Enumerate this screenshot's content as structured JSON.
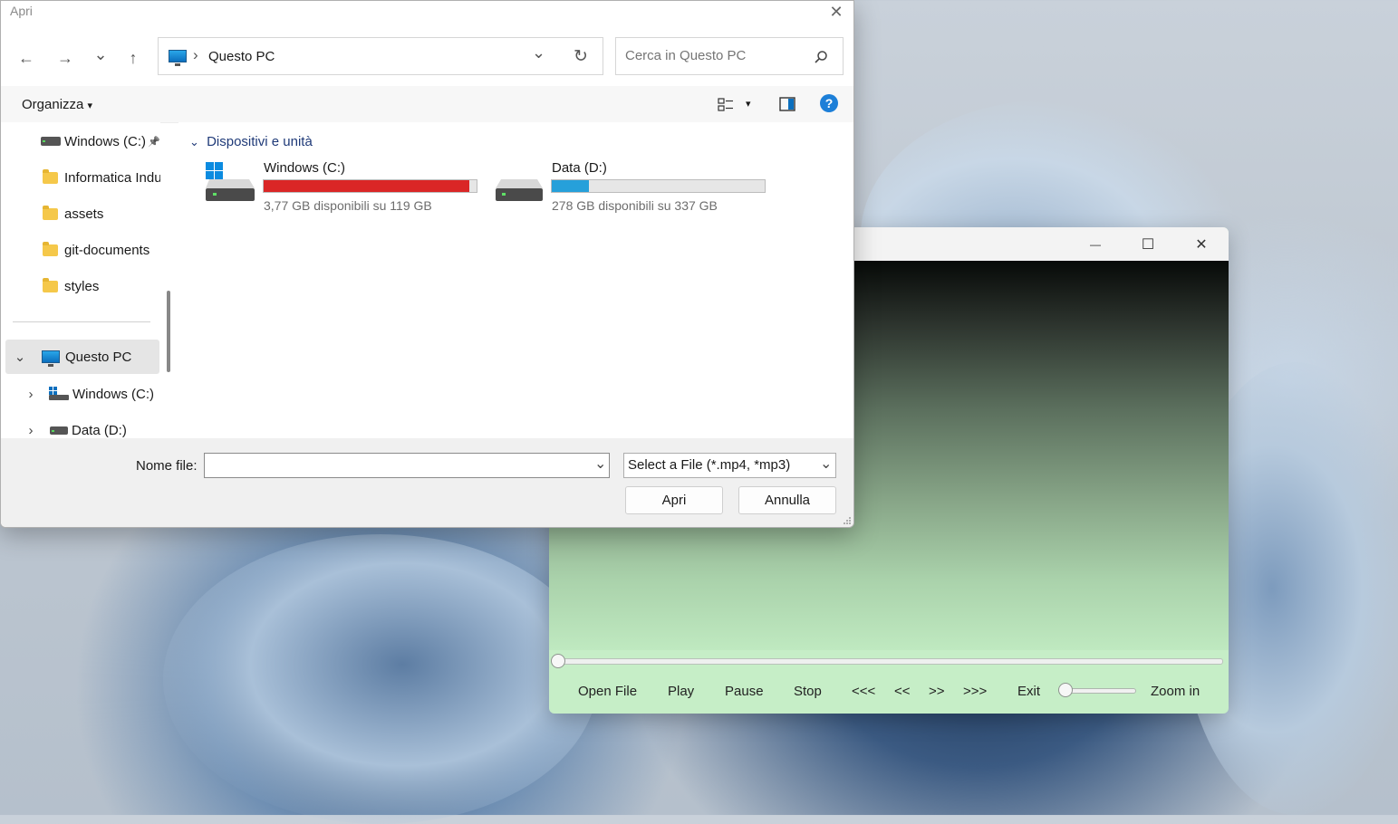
{
  "dialog": {
    "title": "Apri",
    "close_glyph": "✕",
    "nav": {
      "back": "←",
      "forward": "→",
      "recent": "⌄",
      "up": "↑"
    },
    "address": {
      "location": "Questo PC",
      "separator": "›",
      "chevron": "⌄",
      "refresh": "↻"
    },
    "search": {
      "placeholder": "Cerca in Questo PC"
    },
    "toolbar": {
      "organize_label": "Organizza",
      "organize_arrow": "▾",
      "view_arrow": "▾",
      "help": "?"
    },
    "sidebar": {
      "items": [
        {
          "label": "Windows (C:)",
          "icon": "drive-icon",
          "pin": "📌"
        },
        {
          "label": "Informatica Indu",
          "icon": "folder-icon"
        },
        {
          "label": "assets",
          "icon": "folder-icon"
        },
        {
          "label": "git-documents",
          "icon": "folder-icon"
        },
        {
          "label": "styles",
          "icon": "folder-icon"
        }
      ],
      "tree": [
        {
          "label": "Questo PC",
          "icon": "pc-icon",
          "expander": "⌄"
        },
        {
          "label": "Windows (C:)",
          "icon": "windows-drive-icon",
          "expander": "›"
        },
        {
          "label": "Data (D:)",
          "icon": "drive-icon",
          "expander": "›"
        }
      ]
    },
    "group": {
      "label": "Dispositivi e unità",
      "chevron": "⌄"
    },
    "drives": [
      {
        "name": "Windows (C:)",
        "free_text": "3,77 GB disponibili su 119 GB",
        "used_fraction": 0.968,
        "bar_color": "#da2626"
      },
      {
        "name": "Data (D:)",
        "free_text": "278 GB disponibili su 337 GB",
        "used_fraction": 0.175,
        "bar_color": "#26a0da"
      }
    ],
    "footer": {
      "filename_label": "Nome file:",
      "filename_value": "",
      "filetype_value": "Select a File (*.mp4, *mp3)",
      "dropdown_glyph": "⌄",
      "open_label": "Apri",
      "cancel_label": "Annulla"
    }
  },
  "player": {
    "window_controls": {
      "minimize": "—",
      "maximize": "☐",
      "close": "✕"
    },
    "seek_fraction": 0.0,
    "zoom_fraction": 0.0,
    "buttons": {
      "open": "Open File",
      "play": "Play",
      "pause": "Pause",
      "stop": "Stop",
      "rewind_fast": "<<<",
      "rewind": "<<",
      "forward": ">>",
      "forward_fast": ">>>",
      "exit": "Exit",
      "zoom": "Zoom in"
    }
  },
  "colors": {
    "accent": "#0067c0",
    "player_bg": "#c6eec7",
    "help_blue": "#1d7fd8"
  }
}
